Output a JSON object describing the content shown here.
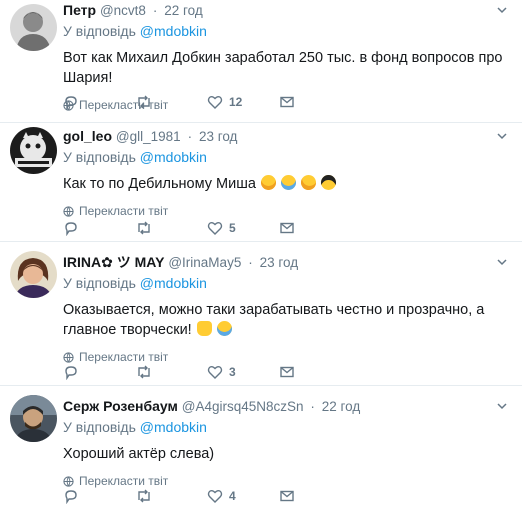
{
  "reply_prefix": "У відповідь",
  "translate_label": "Перекласти твіт",
  "tweets": [
    {
      "fullname": "Петр",
      "handle": "@ncvt8",
      "time": "22 год",
      "mention": "@mdobkin",
      "text": "Вот как Михаил Добкин заработал 250 тыс. в фонд вопросов про Шария!",
      "replies": "",
      "retweets": "",
      "likes": "12",
      "emojis": []
    },
    {
      "fullname": "gol_leo",
      "handle": "@gll_1981",
      "time": "23 год",
      "mention": "@mdobkin",
      "text": "Как то по Дебильному Миша",
      "replies": "",
      "retweets": "",
      "likes": "5",
      "emojis": [
        "grinning-face",
        "tears-of-joy-face",
        "rolling-laughing-face",
        "sunglasses-face"
      ]
    },
    {
      "fullname": "IRINA✿ ツ MAY",
      "handle": "@IrinaMay5",
      "time": "23 год",
      "mention": "@mdobkin",
      "text": "Оказывается, можно таки зарабатывать честно и прозрачно, а главное творчески!",
      "replies": "",
      "retweets": "",
      "likes": "3",
      "emojis": [
        "thumbs-up",
        "tears-of-joy-face"
      ]
    },
    {
      "fullname": "Серж Розенбаум",
      "handle": "@A4girsq45N8czSn",
      "time": "22 год",
      "mention": "@mdobkin",
      "text": "Хороший актёр слева)",
      "replies": "",
      "retweets": "",
      "likes": "4",
      "emojis": []
    }
  ],
  "colors": {
    "link": "#1b95e0",
    "secondary": "#657786",
    "border": "#e6ecf0"
  }
}
